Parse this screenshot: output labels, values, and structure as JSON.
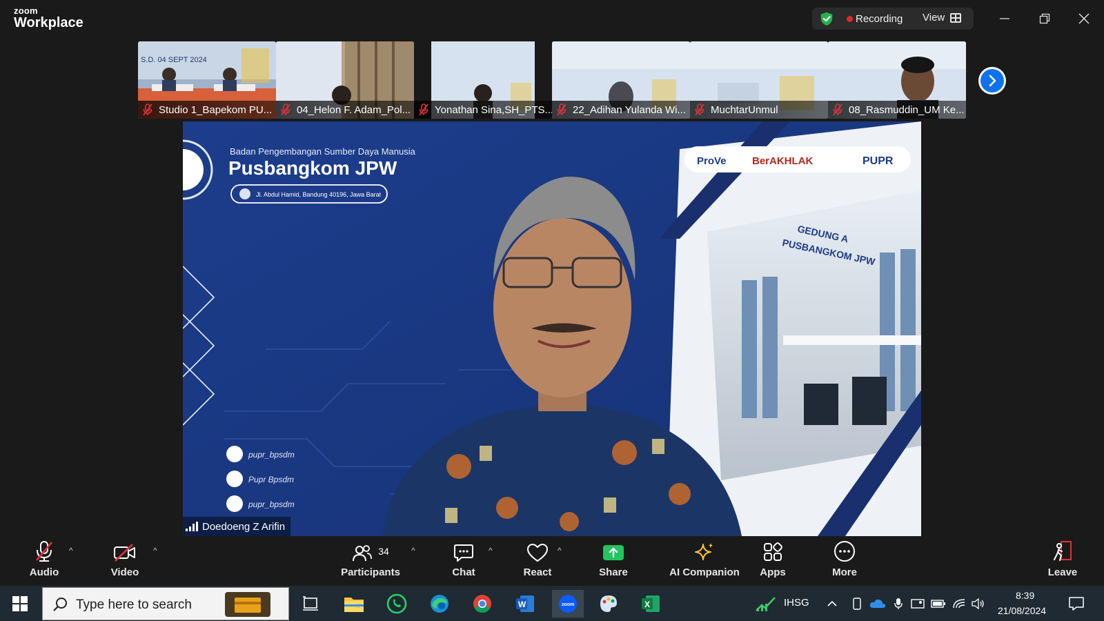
{
  "app": {
    "brand_small": "zoom",
    "brand_big": "Workplace",
    "recording_label": "Recording",
    "view_label": "View"
  },
  "thumbnails": [
    {
      "name": "Studio 1_Bapekom PU..."
    },
    {
      "name": "04_Helon  F. Adam_Pol..."
    },
    {
      "name": "Yonathan Sina,SH_PTS...."
    },
    {
      "name": "22_Adihan Yulanda Wi..."
    },
    {
      "name": "MuchtarUnmul"
    },
    {
      "name": "08_Rasmuddin_UM Ke..."
    }
  ],
  "slide": {
    "org_line": "Badan Pengembangan Sumber Daya Manusia",
    "title": "Pusbangkom JPW",
    "address": "Jl. Abdul Hamid, Bandung 40196, Jawa Barat",
    "logos": [
      "ProVe",
      "BerAKHLAK",
      "PUPR"
    ],
    "building_sign": [
      "GEDUNG A",
      "PUSBANGKOM JPW"
    ],
    "socials": [
      "pupr_bpsdm",
      "Pupr Bpsdm",
      "pupr_bpsdm"
    ],
    "thumb_date_text": "S.D. 04 SEPT 2024"
  },
  "main": {
    "speaker_name": "Doedoeng Z Arifin"
  },
  "toolbar": {
    "audio": "Audio",
    "video": "Video",
    "participants": "Participants",
    "participants_count": "34",
    "chat": "Chat",
    "react": "React",
    "share": "Share",
    "ai_companion": "AI Companion",
    "apps": "Apps",
    "more": "More",
    "leave": "Leave"
  },
  "taskbar": {
    "search_placeholder": "Type here to search",
    "stock_label": "IHSG",
    "time": "8:39",
    "date": "21/08/2024"
  },
  "colors": {
    "accent_blue": "#0e72ed",
    "recording_red": "#e02828",
    "share_green": "#22c55e",
    "muted_red": "#e0303a",
    "slide_blue": "#1e3f8f"
  }
}
